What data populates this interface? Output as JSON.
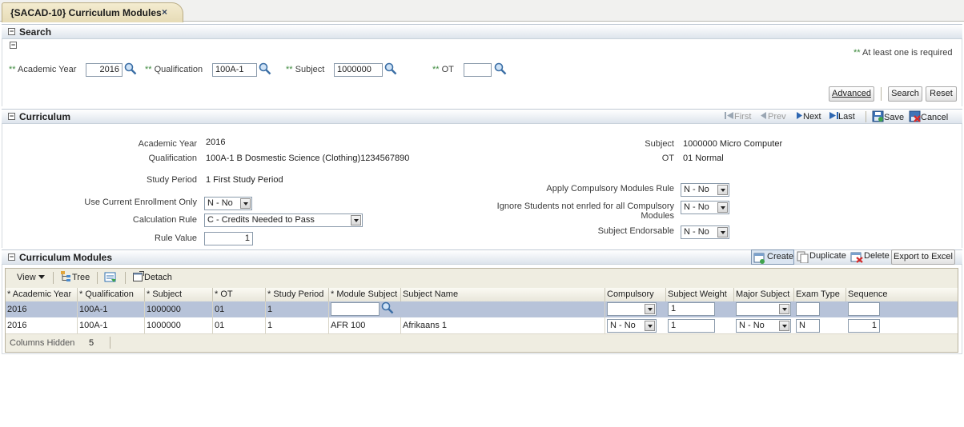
{
  "tab": {
    "title": "{SACAD-10} Curriculum Modules",
    "close": "×"
  },
  "search": {
    "header": "Search",
    "note_stars": "**",
    "note": "At least one is required",
    "fields": {
      "academic_year": {
        "stars": "**",
        "label": "Academic Year",
        "value": "2016"
      },
      "qualification": {
        "stars": "**",
        "label": "Qualification",
        "value": "100A-1"
      },
      "subject": {
        "stars": "**",
        "label": "Subject",
        "value": "1000000"
      },
      "ot": {
        "stars": "**",
        "label": "OT",
        "value": ""
      }
    },
    "buttons": {
      "advanced": "Advanced",
      "search": "Search",
      "reset": "Reset"
    }
  },
  "curriculum": {
    "header": "Curriculum",
    "nav": {
      "first": "First",
      "prev": "Prev",
      "next": "Next",
      "last": "Last",
      "save": "Save",
      "cancel": "Cancel"
    },
    "left": {
      "academic_year_label": "Academic Year",
      "academic_year_value": "2016",
      "qualification_label": "Qualification",
      "qualification_value": "100A-1  B Dosmestic Science (Clothing)1234567890",
      "study_period_label": "Study Period",
      "study_period_value": "1  First Study Period",
      "use_current_label": "Use Current Enrollment Only",
      "use_current_value": "N - No",
      "calc_rule_label": "Calculation Rule",
      "calc_rule_value": "C - Credits Needed to Pass",
      "rule_value_label": "Rule Value",
      "rule_value_value": "1"
    },
    "right": {
      "subject_label": "Subject",
      "subject_value": "1000000  Micro Computer",
      "ot_label": "OT",
      "ot_value": "01  Normal",
      "apply_comp_label": "Apply Compulsory Modules Rule",
      "apply_comp_value": "N - No",
      "ignore_label_1": "Ignore Students not enrled for all Compulsory",
      "ignore_label_2": "Modules",
      "ignore_value": "N - No",
      "endorsable_label": "Subject Endorsable",
      "endorsable_value": "N - No"
    }
  },
  "modules": {
    "header": "Curriculum Modules",
    "actions": {
      "create": "Create",
      "duplicate": "Duplicate",
      "delete": "Delete",
      "export": "Export to Excel"
    },
    "toolbar": {
      "view": "View",
      "tree": "Tree",
      "detach": "Detach"
    },
    "columns": [
      "* Academic Year",
      "* Qualification",
      "* Subject",
      "* OT",
      "* Study Period",
      "* Module Subject",
      "Subject Name",
      "Compulsory",
      "Subject Weight",
      "Major Subject",
      "Exam Type",
      "Sequence"
    ],
    "rows": [
      {
        "academic_year": "2016",
        "qualification": "100A-1",
        "subject": "1000000",
        "ot": "01",
        "study_period": "1",
        "module_subject": "",
        "subject_name": "",
        "compulsory": "",
        "subject_weight": "1",
        "major_subject": "",
        "exam_type": "",
        "sequence": ""
      },
      {
        "academic_year": "2016",
        "qualification": "100A-1",
        "subject": "1000000",
        "ot": "01",
        "study_period": "1",
        "module_subject": "AFR 100",
        "subject_name": "Afrikaans 1",
        "compulsory": "N - No",
        "subject_weight": "1",
        "major_subject": "N - No",
        "exam_type": "N",
        "sequence": "1"
      }
    ],
    "footer": {
      "columns_hidden_label": "Columns Hidden",
      "columns_hidden_value": "5"
    }
  },
  "colors": {
    "header_bg": "#dde4ec",
    "selected_row": "#b7c3d9",
    "required": "#3e8a3e"
  }
}
